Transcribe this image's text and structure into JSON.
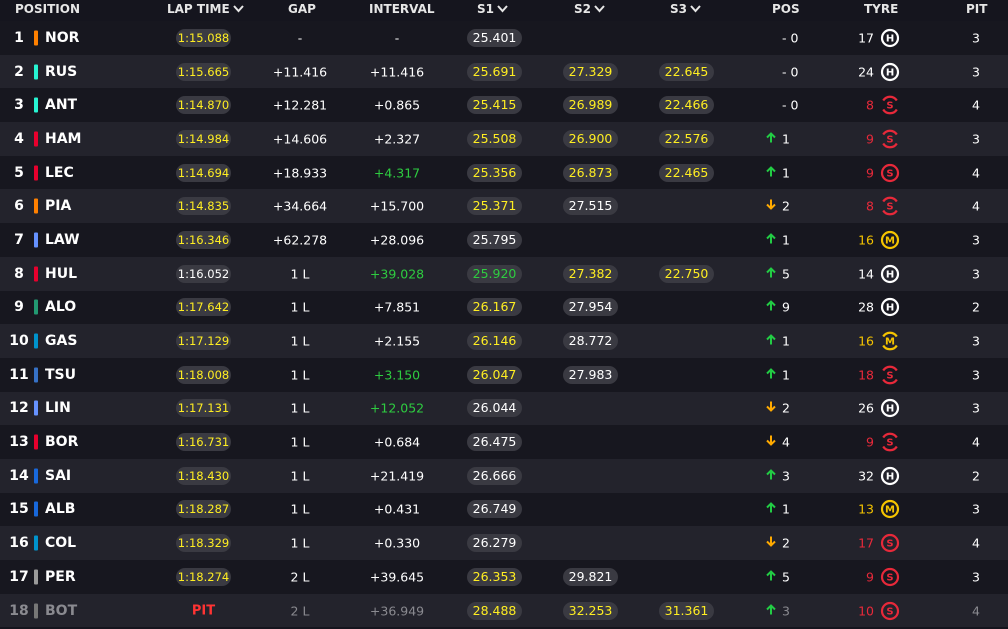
{
  "colors": {
    "background": "#15151e",
    "row_alt": "#23232c",
    "pill": "#3a3a42",
    "personal_best": "#ffee22",
    "fastest": "#2ecc40",
    "gain": "#22cc44",
    "loss": "#ffaa00",
    "soft": "#e8293a",
    "medium": "#f5c400",
    "hard": "#ffffff"
  },
  "headers": {
    "position": "POSITION",
    "lap_time": "LAP TIME",
    "gap": "GAP",
    "interval": "INTERVAL",
    "s1": "S1",
    "s2": "S2",
    "s3": "S3",
    "pos": "POS",
    "tyre": "TYRE",
    "pit": "PIT"
  },
  "rows": [
    {
      "pos": "1",
      "code": "NOR",
      "team_color": "#ff8000",
      "lap": "1:15.088",
      "lap_hl": "y",
      "gap": "-",
      "interval": "-",
      "int_hl": "w",
      "s1": "25.401",
      "s1_hl": "w",
      "s2": "",
      "s2_hl": "w",
      "s3": "",
      "s3_hl": "w",
      "change_dir": "none",
      "change": "- 0",
      "tyre_laps": "17",
      "tyre": "H",
      "tyre_new": false,
      "stops": "3"
    },
    {
      "pos": "2",
      "code": "RUS",
      "team_color": "#27f4d2",
      "lap": "1:15.665",
      "lap_hl": "y",
      "gap": "+11.416",
      "interval": "+11.416",
      "int_hl": "w",
      "s1": "25.691",
      "s1_hl": "y",
      "s2": "27.329",
      "s2_hl": "y",
      "s3": "22.645",
      "s3_hl": "y",
      "change_dir": "none",
      "change": "- 0",
      "tyre_laps": "24",
      "tyre": "H",
      "tyre_new": false,
      "stops": "3"
    },
    {
      "pos": "3",
      "code": "ANT",
      "team_color": "#27f4d2",
      "lap": "1:14.870",
      "lap_hl": "y",
      "gap": "+12.281",
      "interval": "+0.865",
      "int_hl": "w",
      "s1": "25.415",
      "s1_hl": "y",
      "s2": "26.989",
      "s2_hl": "y",
      "s3": "22.466",
      "s3_hl": "y",
      "change_dir": "none",
      "change": "- 0",
      "tyre_laps": "8",
      "tyre": "S",
      "tyre_new": true,
      "stops": "4"
    },
    {
      "pos": "4",
      "code": "HAM",
      "team_color": "#e8002d",
      "lap": "1:14.984",
      "lap_hl": "y",
      "gap": "+14.606",
      "interval": "+2.327",
      "int_hl": "w",
      "s1": "25.508",
      "s1_hl": "y",
      "s2": "26.900",
      "s2_hl": "y",
      "s3": "22.576",
      "s3_hl": "y",
      "change_dir": "up",
      "change": "1",
      "tyre_laps": "9",
      "tyre": "S",
      "tyre_new": true,
      "stops": "3"
    },
    {
      "pos": "5",
      "code": "LEC",
      "team_color": "#e8002d",
      "lap": "1:14.694",
      "lap_hl": "y",
      "gap": "+18.933",
      "interval": "+4.317",
      "int_hl": "g",
      "s1": "25.356",
      "s1_hl": "y",
      "s2": "26.873",
      "s2_hl": "y",
      "s3": "22.465",
      "s3_hl": "y",
      "change_dir": "up",
      "change": "1",
      "tyre_laps": "9",
      "tyre": "S",
      "tyre_new": false,
      "stops": "4"
    },
    {
      "pos": "6",
      "code": "PIA",
      "team_color": "#ff8000",
      "lap": "1:14.835",
      "lap_hl": "y",
      "gap": "+34.664",
      "interval": "+15.700",
      "int_hl": "w",
      "s1": "25.371",
      "s1_hl": "y",
      "s2": "27.515",
      "s2_hl": "w",
      "s3": "",
      "s3_hl": "w",
      "change_dir": "down",
      "change": "2",
      "tyre_laps": "8",
      "tyre": "S",
      "tyre_new": true,
      "stops": "4"
    },
    {
      "pos": "7",
      "code": "LAW",
      "team_color": "#6692ff",
      "lap": "1:16.346",
      "lap_hl": "y",
      "gap": "+62.278",
      "interval": "+28.096",
      "int_hl": "w",
      "s1": "25.795",
      "s1_hl": "w",
      "s2": "",
      "s2_hl": "w",
      "s3": "",
      "s3_hl": "w",
      "change_dir": "up",
      "change": "1",
      "tyre_laps": "16",
      "tyre": "M",
      "tyre_new": false,
      "stops": "3"
    },
    {
      "pos": "8",
      "code": "HUL",
      "team_color": "#e8002d",
      "lap": "1:16.052",
      "lap_hl": "w",
      "gap": "1 L",
      "interval": "+39.028",
      "int_hl": "g",
      "s1": "25.920",
      "s1_hl": "g",
      "s2": "27.382",
      "s2_hl": "y",
      "s3": "22.750",
      "s3_hl": "y",
      "change_dir": "up",
      "change": "5",
      "tyre_laps": "14",
      "tyre": "H",
      "tyre_new": false,
      "stops": "3"
    },
    {
      "pos": "9",
      "code": "ALO",
      "team_color": "#229971",
      "lap": "1:17.642",
      "lap_hl": "y",
      "gap": "1 L",
      "interval": "+7.851",
      "int_hl": "w",
      "s1": "26.167",
      "s1_hl": "y",
      "s2": "27.954",
      "s2_hl": "w",
      "s3": "",
      "s3_hl": "w",
      "change_dir": "up",
      "change": "9",
      "tyre_laps": "28",
      "tyre": "H",
      "tyre_new": false,
      "stops": "2"
    },
    {
      "pos": "10",
      "code": "GAS",
      "team_color": "#0093cc",
      "lap": "1:17.129",
      "lap_hl": "y",
      "gap": "1 L",
      "interval": "+2.155",
      "int_hl": "w",
      "s1": "26.146",
      "s1_hl": "y",
      "s2": "28.772",
      "s2_hl": "w",
      "s3": "",
      "s3_hl": "w",
      "change_dir": "up",
      "change": "1",
      "tyre_laps": "16",
      "tyre": "M",
      "tyre_new": true,
      "stops": "3"
    },
    {
      "pos": "11",
      "code": "TSU",
      "team_color": "#3671c6",
      "lap": "1:18.008",
      "lap_hl": "y",
      "gap": "1 L",
      "interval": "+3.150",
      "int_hl": "g",
      "s1": "26.047",
      "s1_hl": "y",
      "s2": "27.983",
      "s2_hl": "w",
      "s3": "",
      "s3_hl": "w",
      "change_dir": "up",
      "change": "1",
      "tyre_laps": "18",
      "tyre": "S",
      "tyre_new": true,
      "stops": "3"
    },
    {
      "pos": "12",
      "code": "LIN",
      "team_color": "#6692ff",
      "lap": "1:17.131",
      "lap_hl": "y",
      "gap": "1 L",
      "interval": "+12.052",
      "int_hl": "g",
      "s1": "26.044",
      "s1_hl": "w",
      "s2": "",
      "s2_hl": "w",
      "s3": "",
      "s3_hl": "w",
      "change_dir": "down",
      "change": "2",
      "tyre_laps": "26",
      "tyre": "H",
      "tyre_new": false,
      "stops": "3"
    },
    {
      "pos": "13",
      "code": "BOR",
      "team_color": "#e8002d",
      "lap": "1:16.731",
      "lap_hl": "y",
      "gap": "1 L",
      "interval": "+0.684",
      "int_hl": "w",
      "s1": "26.475",
      "s1_hl": "w",
      "s2": "",
      "s2_hl": "w",
      "s3": "",
      "s3_hl": "w",
      "change_dir": "down",
      "change": "4",
      "tyre_laps": "9",
      "tyre": "S",
      "tyre_new": true,
      "stops": "4"
    },
    {
      "pos": "14",
      "code": "SAI",
      "team_color": "#1868db",
      "lap": "1:18.430",
      "lap_hl": "y",
      "gap": "1 L",
      "interval": "+21.419",
      "int_hl": "w",
      "s1": "26.666",
      "s1_hl": "w",
      "s2": "",
      "s2_hl": "w",
      "s3": "",
      "s3_hl": "w",
      "change_dir": "up",
      "change": "3",
      "tyre_laps": "32",
      "tyre": "H",
      "tyre_new": false,
      "stops": "2"
    },
    {
      "pos": "15",
      "code": "ALB",
      "team_color": "#1868db",
      "lap": "1:18.287",
      "lap_hl": "y",
      "gap": "1 L",
      "interval": "+0.431",
      "int_hl": "w",
      "s1": "26.749",
      "s1_hl": "w",
      "s2": "",
      "s2_hl": "w",
      "s3": "",
      "s3_hl": "w",
      "change_dir": "up",
      "change": "1",
      "tyre_laps": "13",
      "tyre": "M",
      "tyre_new": false,
      "stops": "3"
    },
    {
      "pos": "16",
      "code": "COL",
      "team_color": "#0093cc",
      "lap": "1:18.329",
      "lap_hl": "y",
      "gap": "1 L",
      "interval": "+0.330",
      "int_hl": "w",
      "s1": "26.279",
      "s1_hl": "w",
      "s2": "",
      "s2_hl": "w",
      "s3": "",
      "s3_hl": "w",
      "change_dir": "down",
      "change": "2",
      "tyre_laps": "17",
      "tyre": "S",
      "tyre_new": false,
      "stops": "4"
    },
    {
      "pos": "17",
      "code": "PER",
      "team_color": "#9a9a9a",
      "lap": "1:18.274",
      "lap_hl": "y",
      "gap": "2 L",
      "interval": "+39.645",
      "int_hl": "w",
      "s1": "26.353",
      "s1_hl": "y",
      "s2": "29.821",
      "s2_hl": "w",
      "s3": "",
      "s3_hl": "w",
      "change_dir": "up",
      "change": "5",
      "tyre_laps": "9",
      "tyre": "S",
      "tyre_new": false,
      "stops": "3"
    },
    {
      "pos": "18",
      "code": "BOT",
      "team_color": "#9a9a9a",
      "lap": "PIT",
      "lap_hl": "pit",
      "gap": "2 L",
      "interval": "+36.949",
      "int_hl": "w",
      "s1": "28.488",
      "s1_hl": "y",
      "s2": "32.253",
      "s2_hl": "y",
      "s3": "31.361",
      "s3_hl": "y",
      "change_dir": "up",
      "change": "3",
      "tyre_laps": "10",
      "tyre": "S",
      "tyre_new": false,
      "stops": "4",
      "retired": true
    }
  ]
}
